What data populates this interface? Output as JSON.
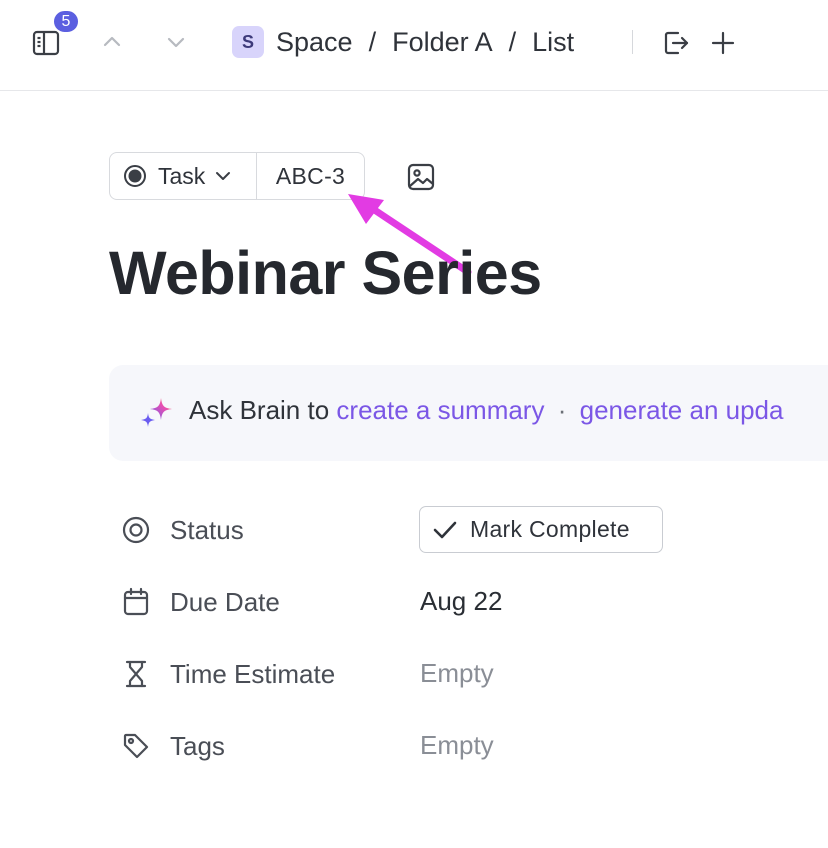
{
  "header": {
    "notification_count": "5",
    "breadcrumb": {
      "space_initial": "S",
      "space": "Space",
      "folder": "Folder A",
      "list": "List",
      "separator": "/"
    }
  },
  "task": {
    "type_label": "Task",
    "id": "ABC-3",
    "title": "Webinar Series"
  },
  "brain": {
    "prefix": "Ask Brain to",
    "action_1": "create a summary",
    "separator": "·",
    "action_2": "generate an upda"
  },
  "properties": {
    "status": {
      "label": "Status",
      "button": "Mark Complete"
    },
    "due_date": {
      "label": "Due Date",
      "value": "Aug 22"
    },
    "time_estimate": {
      "label": "Time Estimate",
      "value": "Empty"
    },
    "tags": {
      "label": "Tags",
      "value": "Empty"
    }
  },
  "colors": {
    "badge": "#5b5fe0",
    "space_avatar": "#d8d4fb",
    "brain_link": "#7b57e6",
    "annotation_arrow": "#e23be3"
  }
}
